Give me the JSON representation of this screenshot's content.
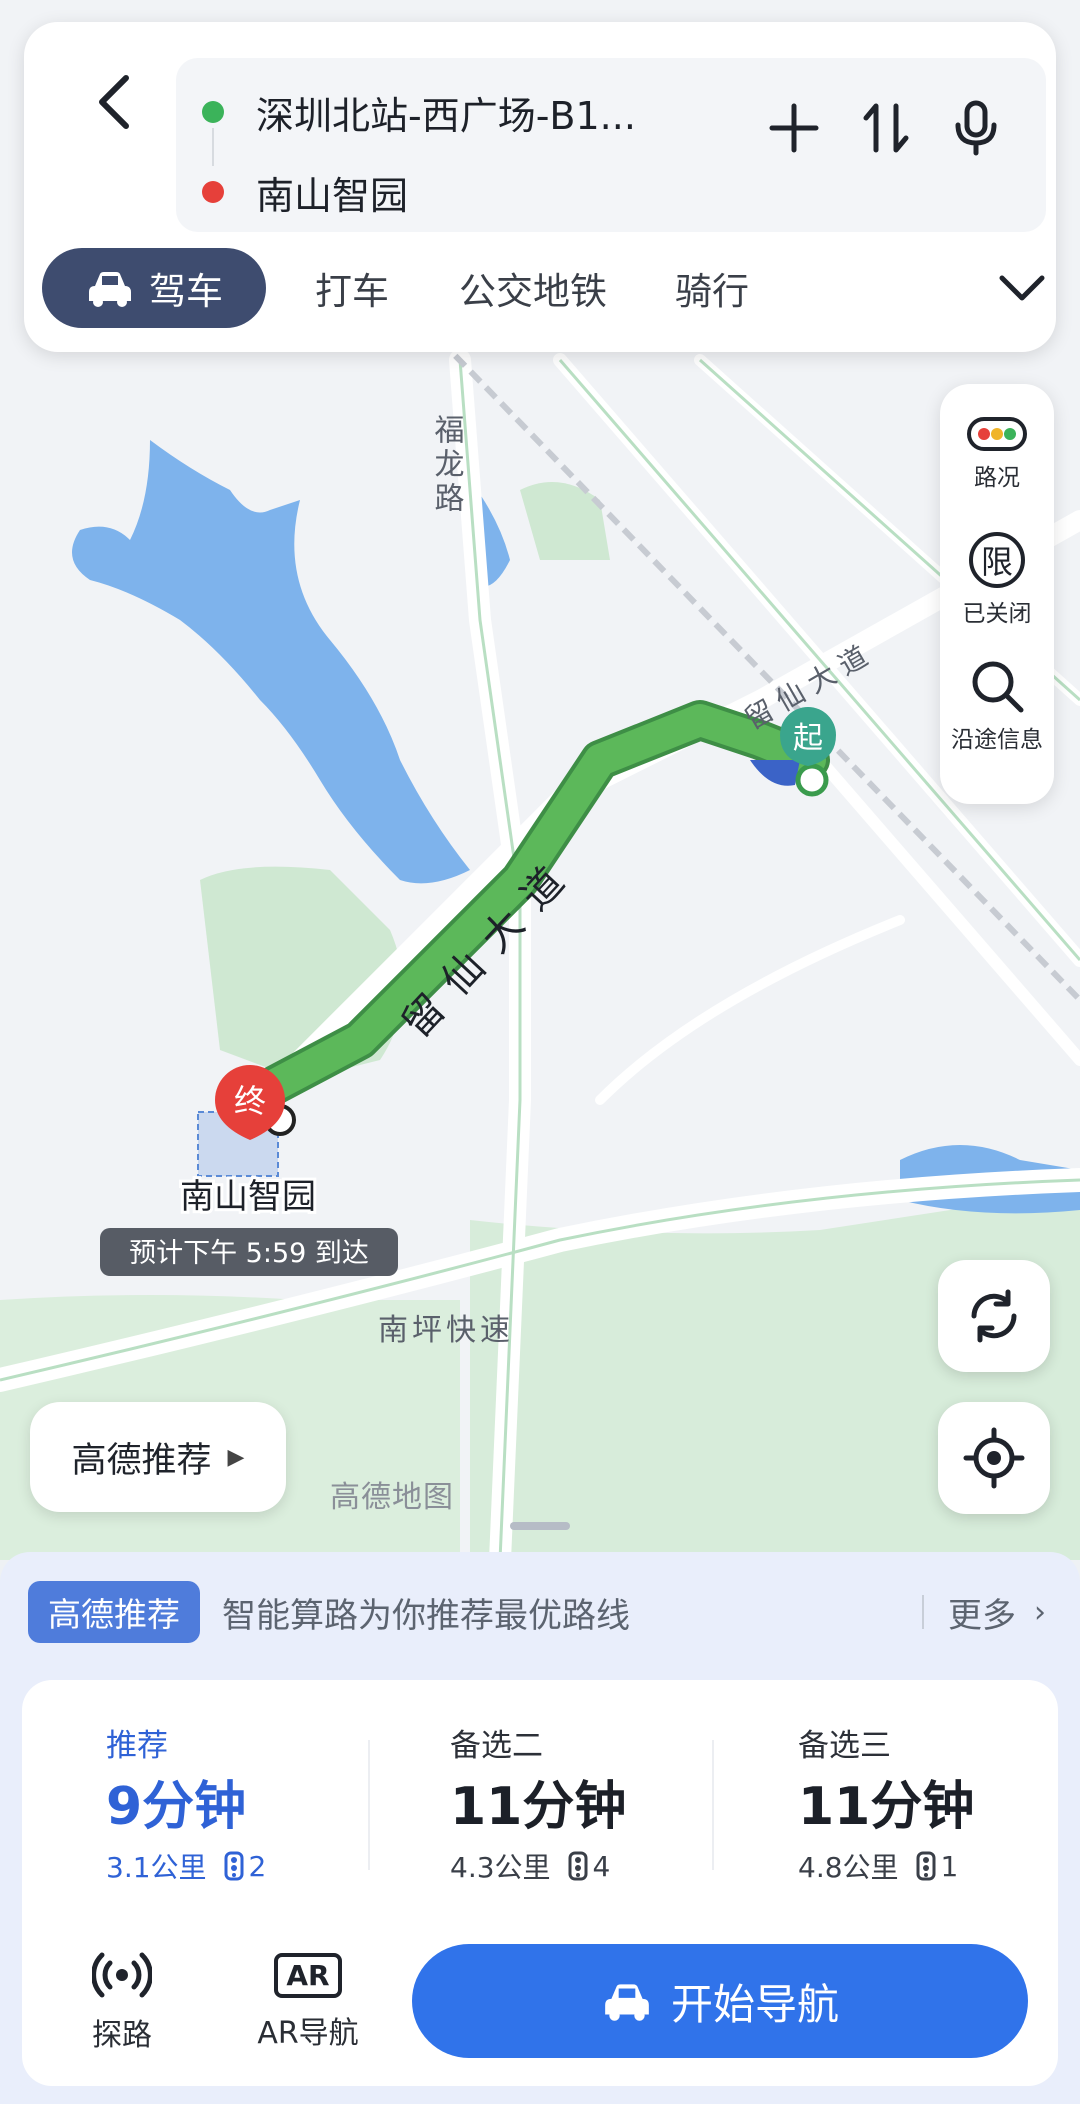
{
  "route": {
    "origin": "深圳北站-西广场-B1...",
    "destination": "南山智园",
    "origin_color": "#3bb35a",
    "destination_color": "#e6403a"
  },
  "toolbar": {
    "back_icon": "chevron-left-icon",
    "add_icon": "plus-icon",
    "swap_icon": "swap-icon",
    "voice_icon": "microphone-icon"
  },
  "tabs": [
    {
      "label": "驾车",
      "active": true,
      "icon": "car-icon"
    },
    {
      "label": "打车",
      "active": false
    },
    {
      "label": "公交地铁",
      "active": false
    },
    {
      "label": "骑行",
      "active": false
    }
  ],
  "side_tools": [
    {
      "label": "路况",
      "icon": "traffic-light-icon"
    },
    {
      "label": "已关闭",
      "icon": "restriction-icon",
      "glyph": "限"
    },
    {
      "label": "沿途信息",
      "icon": "search-icon"
    }
  ],
  "map": {
    "roads": [
      "福龙路",
      "留仙大道",
      "留仙大道",
      "南坪快速"
    ],
    "start_marker": "起",
    "end_marker": "终",
    "destination_label": "南山智园",
    "eta": "预计下午 5:59 到达",
    "watermark": "高德地图",
    "route_color": "#5cb85a",
    "water_color": "#7eb3ec",
    "park_color": "#cfe8d2"
  },
  "recommend_pill": "高德推荐",
  "sheet": {
    "badge": "高德推荐",
    "text": "智能算路为你推荐最优路线",
    "more": "更多"
  },
  "options": [
    {
      "label": "推荐",
      "time": "9分钟",
      "distance": "3.1公里",
      "lights": "2"
    },
    {
      "label": "备选二",
      "time": "11分钟",
      "distance": "4.3公里",
      "lights": "4"
    },
    {
      "label": "备选三",
      "time": "11分钟",
      "distance": "4.8公里",
      "lights": "1"
    }
  ],
  "bottom_tools": [
    {
      "label": "探路",
      "icon": "broadcast-icon"
    },
    {
      "label": "AR导航",
      "icon": "ar-icon",
      "glyph": "AR"
    }
  ],
  "navigate": {
    "label": "开始导航",
    "color": "#3073ea"
  }
}
